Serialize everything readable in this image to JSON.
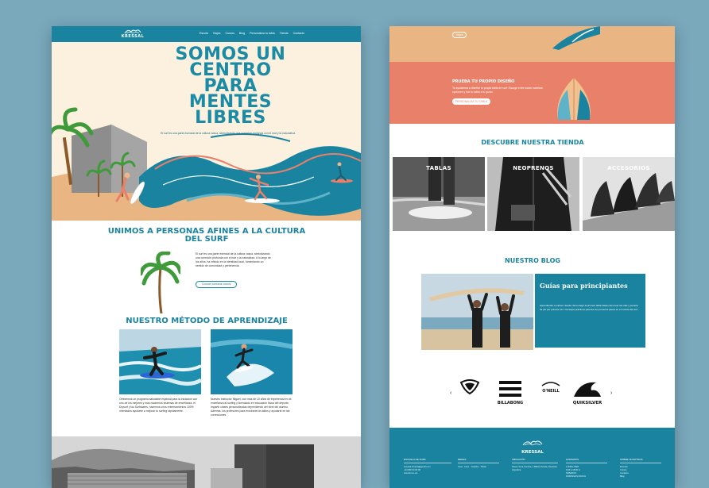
{
  "nav": {
    "logo": "KRESSAL",
    "menu": [
      "Escola",
      "Viajes",
      "Cursos",
      "Blog",
      "Personaliza tu tabla",
      "Tienda",
      "Contacto"
    ]
  },
  "hero": {
    "title_lines": [
      "SOMOS UN",
      "CENTRO",
      "PARA",
      "MENTES",
      "LIBRES"
    ],
    "subtitle": "El surf es una parte esencial de la cultura vasca, simbolizando una conexión profunda con el mar y la naturaleza."
  },
  "unimos": {
    "title": "UNIMOS A PERSONAS AFINES A LA CULTURA DEL SURF",
    "text": "El surf es una parte esencial de la cultura vasca, simbolizando una conexión profunda con el mar y la naturaleza. A lo largo de los años, ha influido en la identidad local, fomentando un sentido de comunidad y pertenencia.",
    "button": "Conoce nuestros cursos"
  },
  "metodo": {
    "title": "NUESTRO MÉTODO DE APRENDIZAJE",
    "text_1": "Ofrecemos un programa saludable especial para la iniciación con uno de los mejores y más modernos sistemas de enseñanza: el Drysurf y los Surfskates, hacemos unos entrenamientos 100% orientados ayudarte a mejorar tu surfing rápidamente.",
    "text_2": "Nuestro instructor Miguel, con más de 10 años de experiencia en la enseñanza al surfing y licenciado en educación física del deporte, impartir clases personalizadas dependiendo del nivel del alumno. Además, los profesores para mostrarte los tallos y ayudarte en las correcciones."
  },
  "right": {
    "band_button": "Viajes",
    "prueba_title": "PRUEBA TU PROPIO DISEÑO",
    "prueba_text": "Te ayudamos a diseñar tu propia tabla de surf. Escoge entre todas nuestras opciones y haz tu tabla a tu gusto.",
    "prueba_button": "PERSONALIZA TU TABLA",
    "tienda_title": "DESCUBRE NUESTRA TIENDA",
    "shop": [
      "TABLAS",
      "NEOPRENOS",
      "ACCESORIOS"
    ],
    "blog_title": "NUESTRO BLOG",
    "blog_card_title": "Guías para principiantes",
    "blog_card_text": "Aprendiendo a surfear: desde cómo elegir la primera tabla hasta cómo leer las olas y ponerte de pie por primera vez. Consejos prácticos para dar tus primeros pasos en el mundo del surf.",
    "brands": [
      "ROXY",
      "BILLABONG",
      "O'NEILL",
      "QUIKSILVER"
    ],
    "footer": {
      "logo": "KRESSAL",
      "columns": [
        {
          "title": "ESCUELA DE SURF",
          "lines": [
            "escuela.kressal@gmail.com",
            "+34 600 00 00 00",
            "Horario lun-vie"
          ]
        },
        {
          "title": "REDES",
          "lines": [
            "Insta · Face · Youtube · Tiktok"
          ]
        },
        {
          "title": "UBICACIÓN",
          "lines": [
            "Paseo de la Concha, 1 Bilbao Zuriola, Donostia",
            "Gipuzkoa"
          ]
        },
        {
          "title": "HORARIOS",
          "lines": [
            "LUNES-VIER",
            "9:00 a 18:00 H",
            "SÁBADOS",
            "DOMINGOS 09:00 H"
          ]
        },
        {
          "title": "SOBRE NOSOTROS",
          "lines": [
            "Escuela",
            "Cursos",
            "Contacto",
            "Blog"
          ]
        }
      ]
    }
  },
  "colors": {
    "teal": "#1a84a0",
    "cream": "#fbf1de",
    "sand": "#e9b582",
    "coral": "#e98069",
    "background": "#7aa9bc"
  }
}
